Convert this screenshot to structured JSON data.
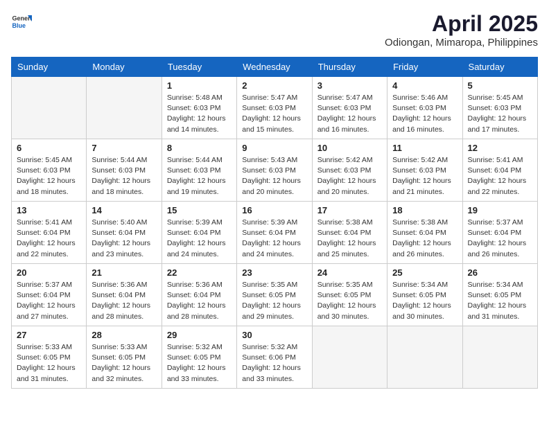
{
  "header": {
    "logo_general": "General",
    "logo_blue": "Blue",
    "month_title": "April 2025",
    "location": "Odiongan, Mimaropa, Philippines"
  },
  "weekdays": [
    "Sunday",
    "Monday",
    "Tuesday",
    "Wednesday",
    "Thursday",
    "Friday",
    "Saturday"
  ],
  "weeks": [
    [
      {
        "day": "",
        "empty": true
      },
      {
        "day": "",
        "empty": true
      },
      {
        "day": "1",
        "sunrise": "Sunrise: 5:48 AM",
        "sunset": "Sunset: 6:03 PM",
        "daylight": "Daylight: 12 hours and 14 minutes."
      },
      {
        "day": "2",
        "sunrise": "Sunrise: 5:47 AM",
        "sunset": "Sunset: 6:03 PM",
        "daylight": "Daylight: 12 hours and 15 minutes."
      },
      {
        "day": "3",
        "sunrise": "Sunrise: 5:47 AM",
        "sunset": "Sunset: 6:03 PM",
        "daylight": "Daylight: 12 hours and 16 minutes."
      },
      {
        "day": "4",
        "sunrise": "Sunrise: 5:46 AM",
        "sunset": "Sunset: 6:03 PM",
        "daylight": "Daylight: 12 hours and 16 minutes."
      },
      {
        "day": "5",
        "sunrise": "Sunrise: 5:45 AM",
        "sunset": "Sunset: 6:03 PM",
        "daylight": "Daylight: 12 hours and 17 minutes."
      }
    ],
    [
      {
        "day": "6",
        "sunrise": "Sunrise: 5:45 AM",
        "sunset": "Sunset: 6:03 PM",
        "daylight": "Daylight: 12 hours and 18 minutes."
      },
      {
        "day": "7",
        "sunrise": "Sunrise: 5:44 AM",
        "sunset": "Sunset: 6:03 PM",
        "daylight": "Daylight: 12 hours and 18 minutes."
      },
      {
        "day": "8",
        "sunrise": "Sunrise: 5:44 AM",
        "sunset": "Sunset: 6:03 PM",
        "daylight": "Daylight: 12 hours and 19 minutes."
      },
      {
        "day": "9",
        "sunrise": "Sunrise: 5:43 AM",
        "sunset": "Sunset: 6:03 PM",
        "daylight": "Daylight: 12 hours and 20 minutes."
      },
      {
        "day": "10",
        "sunrise": "Sunrise: 5:42 AM",
        "sunset": "Sunset: 6:03 PM",
        "daylight": "Daylight: 12 hours and 20 minutes."
      },
      {
        "day": "11",
        "sunrise": "Sunrise: 5:42 AM",
        "sunset": "Sunset: 6:03 PM",
        "daylight": "Daylight: 12 hours and 21 minutes."
      },
      {
        "day": "12",
        "sunrise": "Sunrise: 5:41 AM",
        "sunset": "Sunset: 6:04 PM",
        "daylight": "Daylight: 12 hours and 22 minutes."
      }
    ],
    [
      {
        "day": "13",
        "sunrise": "Sunrise: 5:41 AM",
        "sunset": "Sunset: 6:04 PM",
        "daylight": "Daylight: 12 hours and 22 minutes."
      },
      {
        "day": "14",
        "sunrise": "Sunrise: 5:40 AM",
        "sunset": "Sunset: 6:04 PM",
        "daylight": "Daylight: 12 hours and 23 minutes."
      },
      {
        "day": "15",
        "sunrise": "Sunrise: 5:39 AM",
        "sunset": "Sunset: 6:04 PM",
        "daylight": "Daylight: 12 hours and 24 minutes."
      },
      {
        "day": "16",
        "sunrise": "Sunrise: 5:39 AM",
        "sunset": "Sunset: 6:04 PM",
        "daylight": "Daylight: 12 hours and 24 minutes."
      },
      {
        "day": "17",
        "sunrise": "Sunrise: 5:38 AM",
        "sunset": "Sunset: 6:04 PM",
        "daylight": "Daylight: 12 hours and 25 minutes."
      },
      {
        "day": "18",
        "sunrise": "Sunrise: 5:38 AM",
        "sunset": "Sunset: 6:04 PM",
        "daylight": "Daylight: 12 hours and 26 minutes."
      },
      {
        "day": "19",
        "sunrise": "Sunrise: 5:37 AM",
        "sunset": "Sunset: 6:04 PM",
        "daylight": "Daylight: 12 hours and 26 minutes."
      }
    ],
    [
      {
        "day": "20",
        "sunrise": "Sunrise: 5:37 AM",
        "sunset": "Sunset: 6:04 PM",
        "daylight": "Daylight: 12 hours and 27 minutes."
      },
      {
        "day": "21",
        "sunrise": "Sunrise: 5:36 AM",
        "sunset": "Sunset: 6:04 PM",
        "daylight": "Daylight: 12 hours and 28 minutes."
      },
      {
        "day": "22",
        "sunrise": "Sunrise: 5:36 AM",
        "sunset": "Sunset: 6:04 PM",
        "daylight": "Daylight: 12 hours and 28 minutes."
      },
      {
        "day": "23",
        "sunrise": "Sunrise: 5:35 AM",
        "sunset": "Sunset: 6:05 PM",
        "daylight": "Daylight: 12 hours and 29 minutes."
      },
      {
        "day": "24",
        "sunrise": "Sunrise: 5:35 AM",
        "sunset": "Sunset: 6:05 PM",
        "daylight": "Daylight: 12 hours and 30 minutes."
      },
      {
        "day": "25",
        "sunrise": "Sunrise: 5:34 AM",
        "sunset": "Sunset: 6:05 PM",
        "daylight": "Daylight: 12 hours and 30 minutes."
      },
      {
        "day": "26",
        "sunrise": "Sunrise: 5:34 AM",
        "sunset": "Sunset: 6:05 PM",
        "daylight": "Daylight: 12 hours and 31 minutes."
      }
    ],
    [
      {
        "day": "27",
        "sunrise": "Sunrise: 5:33 AM",
        "sunset": "Sunset: 6:05 PM",
        "daylight": "Daylight: 12 hours and 31 minutes."
      },
      {
        "day": "28",
        "sunrise": "Sunrise: 5:33 AM",
        "sunset": "Sunset: 6:05 PM",
        "daylight": "Daylight: 12 hours and 32 minutes."
      },
      {
        "day": "29",
        "sunrise": "Sunrise: 5:32 AM",
        "sunset": "Sunset: 6:05 PM",
        "daylight": "Daylight: 12 hours and 33 minutes."
      },
      {
        "day": "30",
        "sunrise": "Sunrise: 5:32 AM",
        "sunset": "Sunset: 6:06 PM",
        "daylight": "Daylight: 12 hours and 33 minutes."
      },
      {
        "day": "",
        "empty": true
      },
      {
        "day": "",
        "empty": true
      },
      {
        "day": "",
        "empty": true
      }
    ]
  ]
}
